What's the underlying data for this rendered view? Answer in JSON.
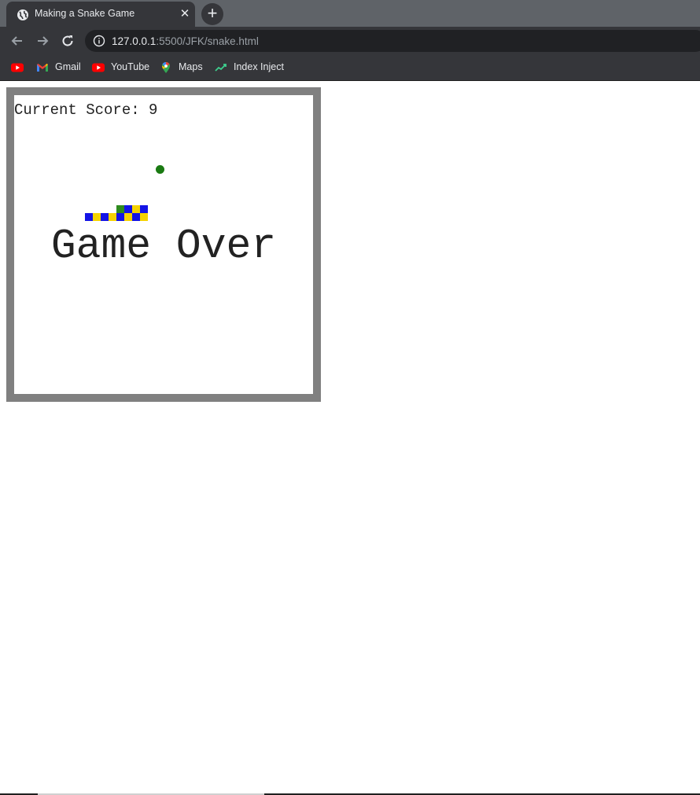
{
  "browser": {
    "tab": {
      "title": "Making a Snake Game",
      "close_glyph": "✕"
    },
    "new_tab_glyph": "+",
    "address": {
      "host": "127.0.0.1",
      "path": ":5500/JFK/snake.html"
    },
    "bookmarks": [
      {
        "label": "Gmail",
        "icon": "gmail-icon"
      },
      {
        "label": "YouTube",
        "icon": "youtube-icon"
      },
      {
        "label": "Maps",
        "icon": "maps-icon"
      },
      {
        "label": "Index Inject",
        "icon": "index-inject-icon"
      }
    ],
    "icons": {
      "tab_favicon": "globe-icon",
      "back": "back-arrow-icon",
      "forward": "forward-arrow-icon",
      "reload": "reload-icon",
      "site_info": "info-icon",
      "first_bookmark": "youtube-icon"
    }
  },
  "game": {
    "score_label": "Current Score: 9",
    "score": 9,
    "status": "Game Over",
    "colors": {
      "border": "#808080",
      "food": "#1a7a12",
      "snake_a": "#1414e6",
      "snake_b": "#f5d300",
      "snake_head": "#2e8b1e"
    }
  }
}
